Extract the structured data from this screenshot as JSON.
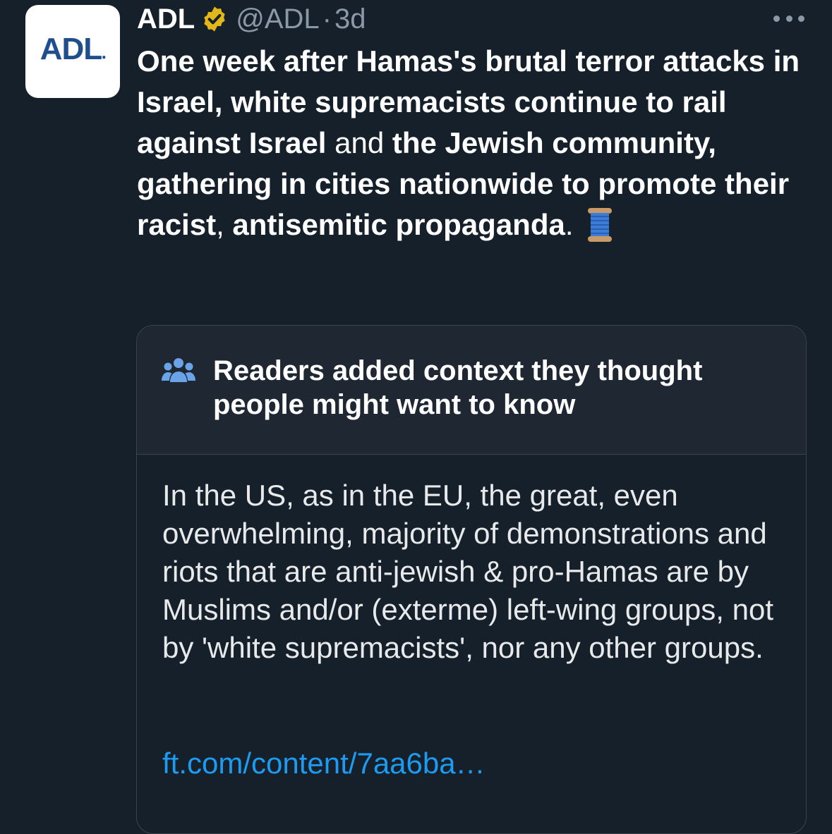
{
  "avatar": {
    "label": "ADL",
    "brand_color": "#1f4e8c"
  },
  "author": {
    "name": "ADL",
    "handle": "@ADL",
    "separator": "·",
    "time": "3d",
    "verified_badge_color": "#e2b719"
  },
  "more_menu": {
    "icon": "more-horizontal-icon"
  },
  "tweet": {
    "segments": [
      {
        "text": "One week after Hamas's brutal terror attacks in Israel, white supremacists continue to rail against Israel",
        "bold": true
      },
      {
        "text": " and ",
        "bold": false
      },
      {
        "text": "the Jewish community, gathering in cities nationwide to promote their racist",
        "bold": true
      },
      {
        "text": ", ",
        "bold": false
      },
      {
        "text": "antisemitic propaganda",
        "bold": true
      },
      {
        "text": ".",
        "bold": false
      }
    ],
    "emoji": "spool-of-thread"
  },
  "community_note": {
    "icon": "people-icon",
    "title": "Readers added context they thought people might want to know",
    "body": "In the US, as in the EU, the great, even overwhelming, majority of demonstrations and riots that are anti-jewish & pro-Hamas are by Muslims and/or (exterme) left-wing groups, not by 'white supremacists', nor any other groups.",
    "link": "ft.com/content/7aa6ba…"
  },
  "colors": {
    "background": "#15202b",
    "note_header": "#1e2732",
    "border": "#38444d",
    "secondary_text": "#8b98a5",
    "link": "#1d9bf0"
  }
}
